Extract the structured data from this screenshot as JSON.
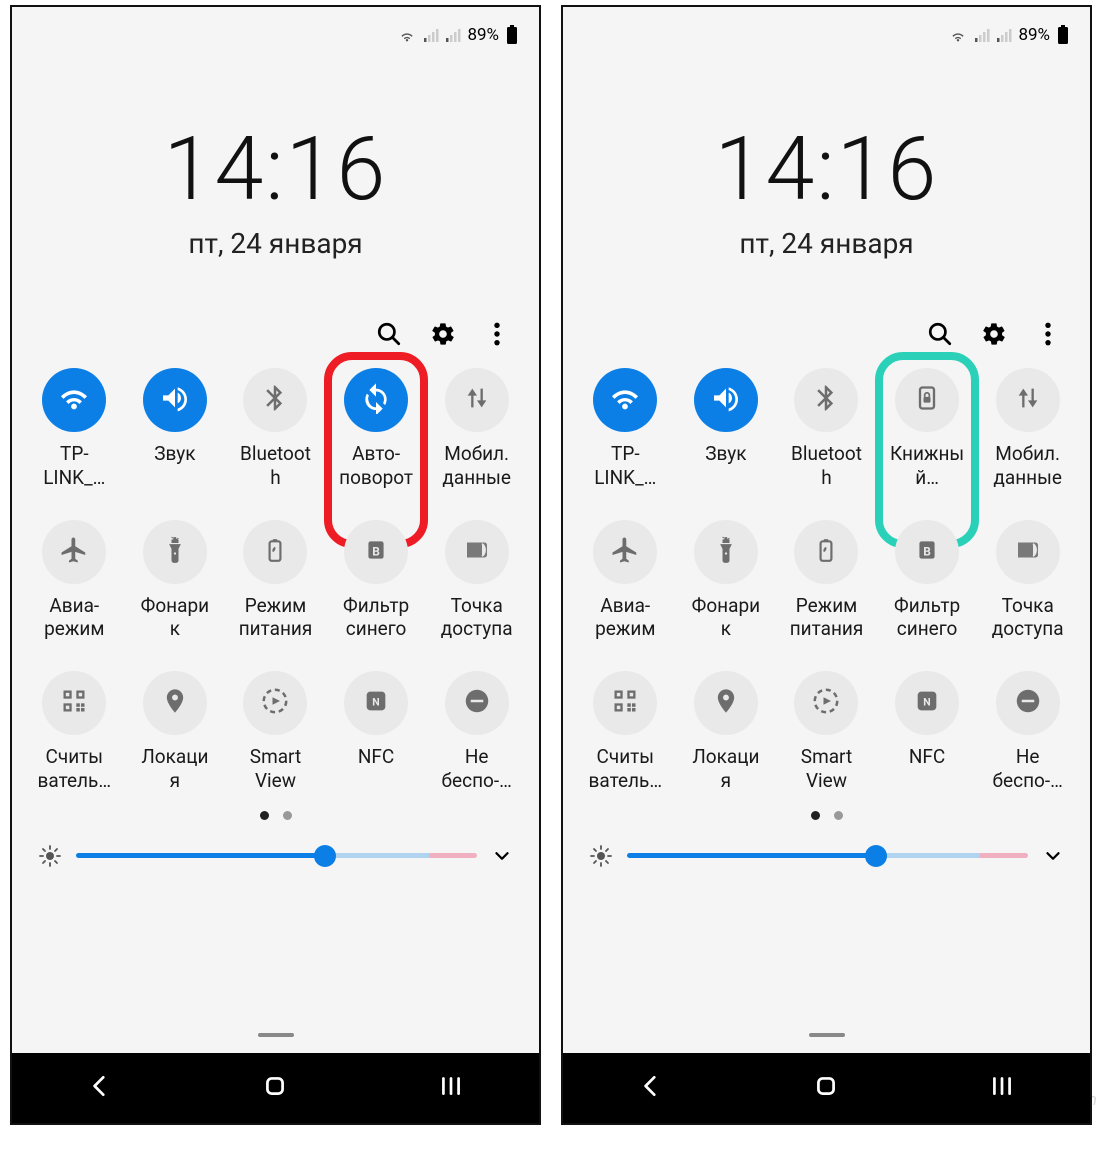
{
  "status": {
    "battery_text": "89%"
  },
  "clock": {
    "time": "14:16",
    "date": "пт, 24 января"
  },
  "screens": [
    {
      "tiles": [
        {
          "id": "wifi",
          "label": "TP-\nLINK_…",
          "icon": "wifi",
          "active": true
        },
        {
          "id": "sound",
          "label": "Звук",
          "icon": "volume",
          "active": true
        },
        {
          "id": "bluetooth",
          "label": "Bluetoot\nh",
          "icon": "bluetooth",
          "active": false
        },
        {
          "id": "rotate",
          "label": "Авто-\nповорот",
          "icon": "rotate",
          "active": true,
          "highlight": "red"
        },
        {
          "id": "mobile",
          "label": "Мобил.\nданные",
          "icon": "data",
          "active": false
        },
        {
          "id": "airplane",
          "label": "Авиа-\nрежим",
          "icon": "airplane",
          "active": false
        },
        {
          "id": "flash",
          "label": "Фонари\nк",
          "icon": "flashlight",
          "active": false
        },
        {
          "id": "power",
          "label": "Режим\nпитания",
          "icon": "battery-leaf",
          "active": false
        },
        {
          "id": "bluefilter",
          "label": "Фильтр\nсинего",
          "icon": "blue-filter",
          "active": false
        },
        {
          "id": "hotspot",
          "label": "Точка\nдоступа",
          "icon": "hotspot",
          "active": false
        },
        {
          "id": "qr",
          "label": "Считы\nватель…",
          "icon": "qr",
          "active": false
        },
        {
          "id": "location",
          "label": "Локаци\nя",
          "icon": "location",
          "active": false
        },
        {
          "id": "smartview",
          "label": "Smart\nView",
          "icon": "smartview",
          "active": false
        },
        {
          "id": "nfc",
          "label": "NFC",
          "icon": "nfc",
          "active": false
        },
        {
          "id": "dnd",
          "label": "Не\nбеспо-…",
          "icon": "dnd",
          "active": false
        }
      ]
    },
    {
      "tiles": [
        {
          "id": "wifi",
          "label": "TP-\nLINK_…",
          "icon": "wifi",
          "active": true
        },
        {
          "id": "sound",
          "label": "Звук",
          "icon": "volume",
          "active": true
        },
        {
          "id": "bluetooth",
          "label": "Bluetoot\nh",
          "icon": "bluetooth",
          "active": false
        },
        {
          "id": "portrait",
          "label": "Книжны\nй…",
          "icon": "portrait-lock",
          "active": false,
          "highlight": "teal"
        },
        {
          "id": "mobile",
          "label": "Мобил.\nданные",
          "icon": "data",
          "active": false
        },
        {
          "id": "airplane",
          "label": "Авиа-\nрежим",
          "icon": "airplane",
          "active": false
        },
        {
          "id": "flash",
          "label": "Фонари\nк",
          "icon": "flashlight",
          "active": false
        },
        {
          "id": "power",
          "label": "Режим\nпитания",
          "icon": "battery-leaf",
          "active": false
        },
        {
          "id": "bluefilter",
          "label": "Фильтр\nсинего",
          "icon": "blue-filter",
          "active": false
        },
        {
          "id": "hotspot",
          "label": "Точка\nдоступа",
          "icon": "hotspot",
          "active": false
        },
        {
          "id": "qr",
          "label": "Считы\nватель…",
          "icon": "qr",
          "active": false
        },
        {
          "id": "location",
          "label": "Локаци\nя",
          "icon": "location",
          "active": false
        },
        {
          "id": "smartview",
          "label": "Smart\nView",
          "icon": "smartview",
          "active": false
        },
        {
          "id": "nfc",
          "label": "NFC",
          "icon": "nfc",
          "active": false
        },
        {
          "id": "dnd",
          "label": "Не\nбеспо-…",
          "icon": "dnd",
          "active": false
        }
      ]
    }
  ],
  "watermark": "user-life.com",
  "colors": {
    "accent": "#0c7fe6",
    "highlight_red": "#ee1c25",
    "highlight_teal": "#2ad1b8"
  }
}
